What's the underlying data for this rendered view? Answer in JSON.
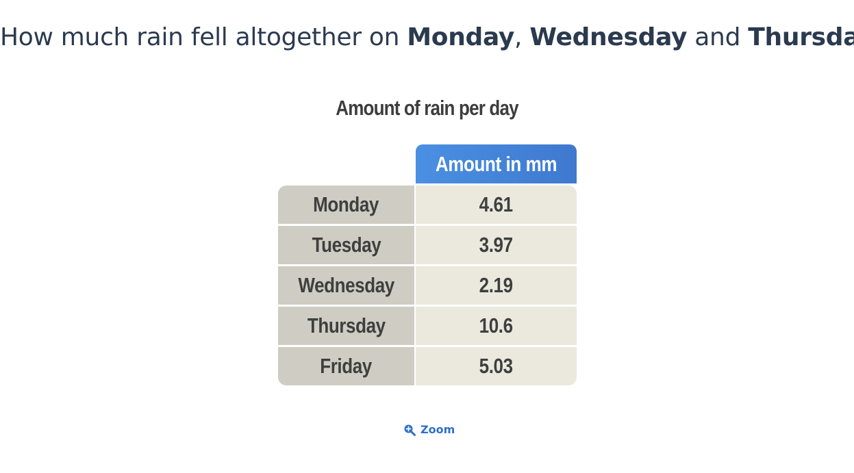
{
  "question": {
    "prefix": "How much rain fell altogether on ",
    "day1": "Monday",
    "sep1": ", ",
    "day2": "Wednesday",
    "sep2": " and ",
    "day3": "Thursday",
    "suffix": "?"
  },
  "table": {
    "title": "Amount of rain per day",
    "column_header": "Amount in mm",
    "rows": [
      {
        "day": "Monday",
        "amount": "4.61"
      },
      {
        "day": "Tuesday",
        "amount": "3.97"
      },
      {
        "day": "Wednesday",
        "amount": "2.19"
      },
      {
        "day": "Thursday",
        "amount": "10.6"
      },
      {
        "day": "Friday",
        "amount": "5.03"
      }
    ]
  },
  "zoom": {
    "label": "Zoom",
    "icon": "zoom-in-icon"
  },
  "colors": {
    "header_blue": "#4a90e2",
    "day_cell": "#cfcdc3",
    "amount_cell": "#ebe8de",
    "text_dark": "#2b3a4f",
    "link_blue": "#2f6fcc"
  }
}
